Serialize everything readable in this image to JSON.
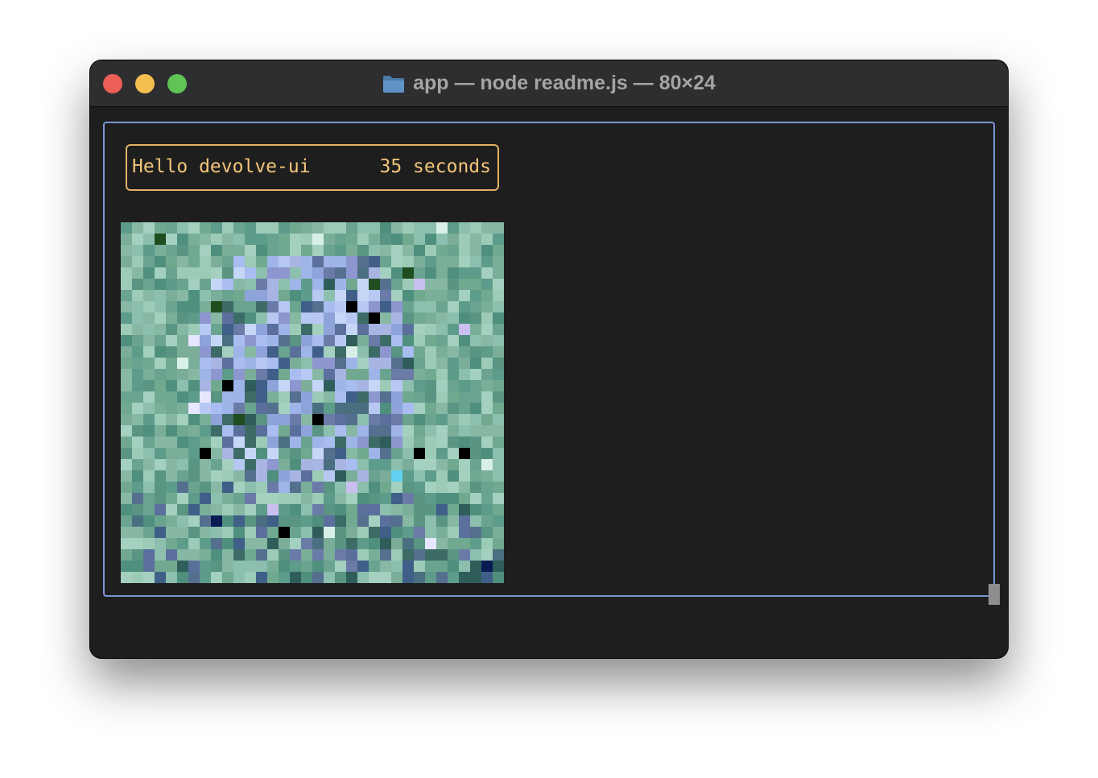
{
  "window": {
    "title": "app — node readme.js — 80×24",
    "title_icon": "folder-icon",
    "traffic_lights": {
      "close_color": "#ec5f57",
      "minimize_color": "#f5bf4f",
      "zoom_color": "#5fc454",
      "close_glyph": "×",
      "minimize_glyph": "−",
      "zoom_glyph": "+"
    }
  },
  "terminal": {
    "header": {
      "greeting": "Hello devolve-ui",
      "timer": "35 seconds"
    },
    "colors": {
      "outer_border": "#7b95d4",
      "header_border": "#e3b266",
      "header_text": "#f2c57a",
      "background": "#1e1e1e"
    },
    "cursor_visible": true
  }
}
